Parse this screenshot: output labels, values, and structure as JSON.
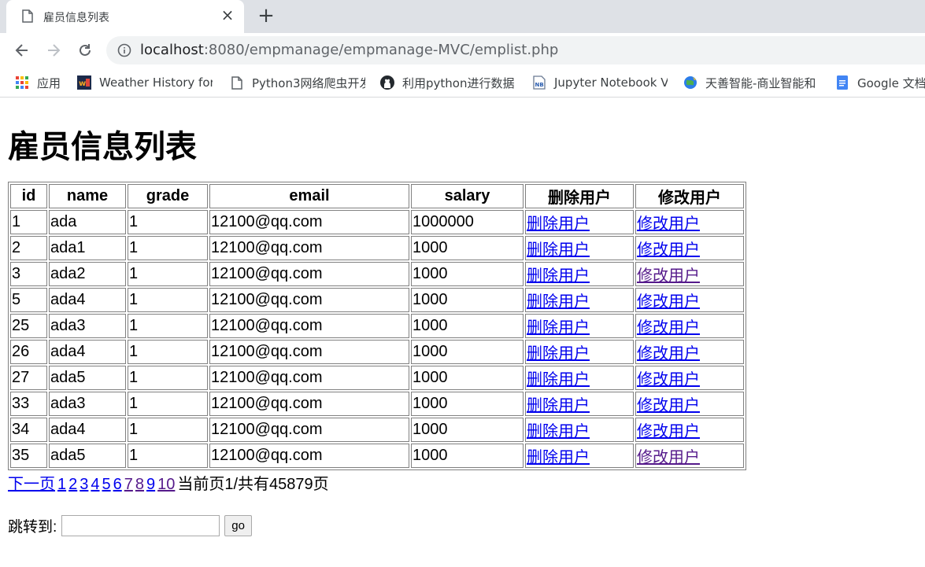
{
  "browser": {
    "tab_title": "雇员信息列表",
    "url_host": "localhost",
    "url_rest": ":8080/empmanage/empmanage-MVC/emplist.php",
    "bookmarks": [
      {
        "label": "应用",
        "icon": "apps-grid-icon"
      },
      {
        "label": "Weather History for",
        "icon": "weather-site-icon"
      },
      {
        "label": "Python3网络爬虫开发",
        "icon": "page-icon"
      },
      {
        "label": "利用python进行数据",
        "icon": "github-icon"
      },
      {
        "label": "Jupyter Notebook V",
        "icon": "notebook-icon"
      },
      {
        "label": "天善智能-商业智能和",
        "icon": "globe-icon"
      },
      {
        "label": "Google 文档",
        "icon": "google-docs-icon"
      }
    ]
  },
  "page": {
    "title": "雇员信息列表",
    "table": {
      "headers": [
        "id",
        "name",
        "grade",
        "email",
        "salary",
        "删除用户",
        "修改用户"
      ],
      "rows": [
        {
          "id": "1",
          "name": "ada",
          "grade": "1",
          "email": "12100@qq.com",
          "salary": "1000000",
          "delete": "删除用户",
          "edit": "修改用户",
          "edit_visited": false
        },
        {
          "id": "2",
          "name": "ada1",
          "grade": "1",
          "email": "12100@qq.com",
          "salary": "1000",
          "delete": "删除用户",
          "edit": "修改用户",
          "edit_visited": false
        },
        {
          "id": "3",
          "name": "ada2",
          "grade": "1",
          "email": "12100@qq.com",
          "salary": "1000",
          "delete": "删除用户",
          "edit": "修改用户",
          "edit_visited": true
        },
        {
          "id": "5",
          "name": "ada4",
          "grade": "1",
          "email": "12100@qq.com",
          "salary": "1000",
          "delete": "删除用户",
          "edit": "修改用户",
          "edit_visited": false
        },
        {
          "id": "25",
          "name": "ada3",
          "grade": "1",
          "email": "12100@qq.com",
          "salary": "1000",
          "delete": "删除用户",
          "edit": "修改用户",
          "edit_visited": false
        },
        {
          "id": "26",
          "name": "ada4",
          "grade": "1",
          "email": "12100@qq.com",
          "salary": "1000",
          "delete": "删除用户",
          "edit": "修改用户",
          "edit_visited": false
        },
        {
          "id": "27",
          "name": "ada5",
          "grade": "1",
          "email": "12100@qq.com",
          "salary": "1000",
          "delete": "删除用户",
          "edit": "修改用户",
          "edit_visited": false
        },
        {
          "id": "33",
          "name": "ada3",
          "grade": "1",
          "email": "12100@qq.com",
          "salary": "1000",
          "delete": "删除用户",
          "edit": "修改用户",
          "edit_visited": false
        },
        {
          "id": "34",
          "name": "ada4",
          "grade": "1",
          "email": "12100@qq.com",
          "salary": "1000",
          "delete": "删除用户",
          "edit": "修改用户",
          "edit_visited": false
        },
        {
          "id": "35",
          "name": "ada5",
          "grade": "1",
          "email": "12100@qq.com",
          "salary": "1000",
          "delete": "删除用户",
          "edit": "修改用户",
          "edit_visited": true
        }
      ]
    },
    "pager": {
      "next_label": "下一页",
      "pages": [
        {
          "label": "1",
          "visited": false
        },
        {
          "label": "2",
          "visited": false
        },
        {
          "label": "3",
          "visited": false
        },
        {
          "label": "4",
          "visited": false
        },
        {
          "label": "5",
          "visited": false
        },
        {
          "label": "6",
          "visited": false
        },
        {
          "label": "7",
          "visited": true
        },
        {
          "label": "8",
          "visited": true
        },
        {
          "label": "9",
          "visited": false
        },
        {
          "label": "10",
          "visited": true
        }
      ],
      "status": "当前页1/共有45879页"
    },
    "jump": {
      "label": "跳转到:",
      "input_value": "",
      "go_label": "go"
    }
  }
}
